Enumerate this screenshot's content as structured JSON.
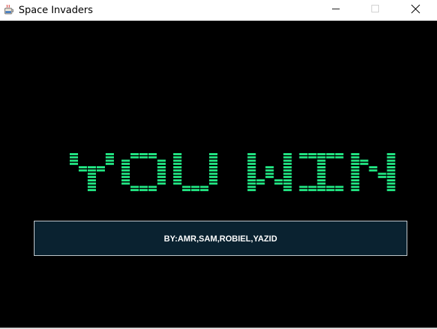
{
  "window": {
    "title": "Space Invaders",
    "icon": "java-cup-icon",
    "controls": [
      "minimize-icon",
      "maximize-icon",
      "close-icon"
    ]
  },
  "game": {
    "headline": "YOU WIN",
    "headline_color": "#22e884",
    "background_color": "#000000",
    "credits": "BY:AMR,SAM,ROBIEL,YAZID",
    "credits_bg": "#0a2230"
  }
}
